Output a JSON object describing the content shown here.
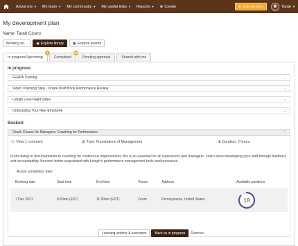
{
  "nav": {
    "items": [
      {
        "label": "About me"
      },
      {
        "label": "My team"
      },
      {
        "label": "My community"
      },
      {
        "label": "My useful links"
      },
      {
        "label": "Reports"
      },
      {
        "label": "Create"
      }
    ],
    "journal_label": "Journal entry",
    "user_name": "Tarah",
    "brand_color": "#5b3419"
  },
  "page": {
    "title": "My development plan",
    "name_line": "Name: Tarah Cicero"
  },
  "buttons": {
    "working_on": "Working on...",
    "explore_library": "Explore library",
    "explore_events": "Explore events"
  },
  "tabs": [
    {
      "label": "In progress/Upcoming",
      "badge": "4"
    },
    {
      "label": "Completed",
      "badge": "36"
    },
    {
      "label": "Pending approval"
    },
    {
      "label": "Shared with me"
    }
  ],
  "in_progress": {
    "heading": "In progress:",
    "items": [
      "FERPA Training",
      "Video: Planning Step - Online Draft Book Performance Review",
      "Lehigh Lean Flight Video",
      "Onboarding Your New Employee"
    ]
  },
  "booked": {
    "heading": "Booked:",
    "course": {
      "title": "Crash Course for Managers: Coaching for Performance",
      "comments": "View 1 comment",
      "type": "Type: Foundations of Management",
      "duration": "Duration: 2 hours",
      "description": "From dialog to documentation to coaching for continuous improvement, this is an essential for all supervisors and managers. Learn about developing your staff through feedback and accountability. Become better acquainted with Lehigh's performance management tools and processes..",
      "actual_completion": "Actual completion date:",
      "table": {
        "headers": [
          "Booking date",
          "Start time",
          "End time",
          "Venue",
          "Address",
          "Available positions"
        ],
        "row": {
          "booking_date": "7 Dec 2021",
          "start_time": "9:30am (EST)",
          "end_time": "11:30am (EST)",
          "venue": "Zoom",
          "address": "Pennsylvania, United States",
          "available_positions": "18",
          "ring_fraction": 0.85
        }
      },
      "actions": {
        "learning_actions": "Learning actions & outcomes",
        "mark_in_progress": "Mark as in progress",
        "remove": "Remove"
      }
    }
  }
}
